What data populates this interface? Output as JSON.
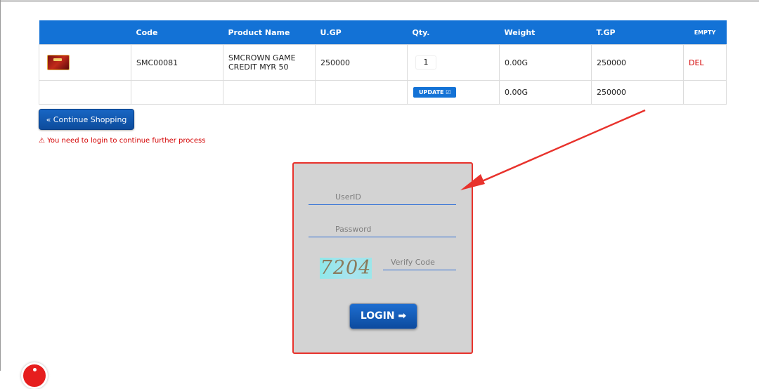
{
  "cart": {
    "headers": {
      "code": "Code",
      "product_name": "Product Name",
      "ugp": "U.GP",
      "qty": "Qty.",
      "weight": "Weight",
      "tgp": "T.GP",
      "empty": "EMPTY"
    },
    "item": {
      "code": "SMC00081",
      "product_name_line1": "SMCROWN GAME",
      "product_name_line2": "CREDIT MYR 50",
      "ugp": "250000",
      "qty": "1",
      "weight": "0.00G",
      "tgp": "250000",
      "del": "DEL"
    },
    "summary": {
      "update_label": "UPDATE ☑",
      "weight": "0.00G",
      "tgp": "250000"
    }
  },
  "continue_label": "« Continue Shopping",
  "warning": "⚠ You need to login to continue further process",
  "login": {
    "userid_placeholder": "UserID",
    "password_placeholder": "Password",
    "captcha_text": "7204",
    "verify_placeholder": "Verify Code",
    "login_label": "LOGIN ➡"
  },
  "colors": {
    "header_blue": "#1372d6",
    "button_blue": "#0d4c9c",
    "alert_red": "#d40000",
    "annotation_red": "#e8322c",
    "login_panel": "#d3d3d3"
  }
}
